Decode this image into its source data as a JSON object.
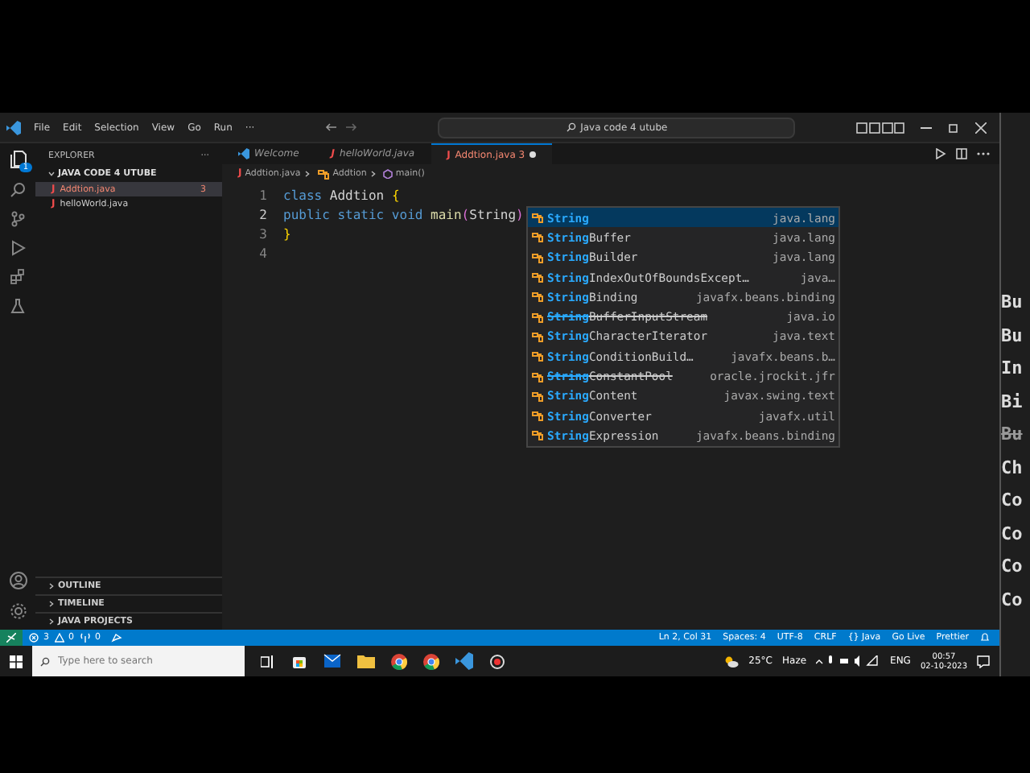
{
  "menu": [
    "File",
    "Edit",
    "Selection",
    "View",
    "Go",
    "Run",
    "···"
  ],
  "command_center": "Java code 4 utube",
  "activity_badge": "1",
  "sidebar": {
    "title": "EXPLORER",
    "more": "···",
    "folder": "JAVA CODE 4 UTUBE",
    "files": [
      {
        "icon": "J",
        "name": "Addtion.java",
        "problems": "3",
        "selected": true
      },
      {
        "icon": "J",
        "name": "helloWorld.java",
        "selected": false
      }
    ],
    "sections": [
      "OUTLINE",
      "TIMELINE",
      "JAVA PROJECTS"
    ]
  },
  "tabs": [
    {
      "label": "Welcome",
      "kind": "welcome",
      "selected": false,
      "dirty": false
    },
    {
      "icon": "J",
      "label": "helloWorld.java",
      "kind": "java",
      "selected": false,
      "dirty": false
    },
    {
      "icon": "J",
      "label": "Addtion.java 3",
      "kind": "java",
      "selected": true,
      "dirty": true
    }
  ],
  "breadcrumb": [
    {
      "icon": "J",
      "label": "Addtion.java",
      "kind": "file"
    },
    {
      "label": "Addtion",
      "kind": "class"
    },
    {
      "label": "main()",
      "kind": "method"
    }
  ],
  "lines": [
    {
      "number": "1",
      "tokens": [
        {
          "text": "class",
          "kind": "keyword"
        },
        {
          "text": " Addtion ",
          "kind": "plain"
        },
        {
          "text": "{",
          "kind": "brace"
        }
      ]
    },
    {
      "number": "2",
      "tokens": [
        {
          "text": "public static void",
          "kind": "keyword"
        },
        {
          "text": " main",
          "kind": "function"
        },
        {
          "text": "(",
          "kind": "paren"
        },
        {
          "text": "String",
          "kind": "plain"
        },
        {
          "text": ")",
          "kind": "paren"
        }
      ]
    },
    {
      "number": "3",
      "tokens": [
        {
          "text": "}",
          "kind": "brace"
        }
      ]
    },
    {
      "number": "4"
    }
  ],
  "suggestions": [
    {
      "match": "String",
      "package": "java.lang",
      "deprecated": false,
      "selected": true
    },
    {
      "match": "String",
      "rest": "Buffer",
      "package": "java.lang",
      "deprecated": false,
      "selected": false
    },
    {
      "match": "String",
      "rest": "Builder",
      "package": "java.lang",
      "deprecated": false,
      "selected": false
    },
    {
      "match": "String",
      "rest": "IndexOutOfBoundsExcept…",
      "package": "java…",
      "deprecated": false,
      "selected": false
    },
    {
      "match": "String",
      "rest": "Binding",
      "package": "javafx.beans.binding",
      "deprecated": false,
      "selected": false
    },
    {
      "match": "String",
      "rest": "BufferInputStream",
      "package": "java.io",
      "deprecated": true,
      "selected": false
    },
    {
      "match": "String",
      "rest": "CharacterIterator",
      "package": "java.text",
      "deprecated": false,
      "selected": false
    },
    {
      "match": "String",
      "rest": "ConditionBuild…",
      "package": "javafx.beans.b…",
      "deprecated": false,
      "selected": false
    },
    {
      "match": "String",
      "rest": "ConstantPool",
      "package": "oracle.jrockit.jfr",
      "deprecated": true,
      "selected": false
    },
    {
      "match": "String",
      "rest": "Content",
      "package": "javax.swing.text",
      "deprecated": false,
      "selected": false
    },
    {
      "match": "String",
      "rest": "Converter",
      "package": "javafx.util",
      "deprecated": false,
      "selected": false
    },
    {
      "match": "String",
      "rest": "Expression",
      "package": "javafx.beans.binding",
      "deprecated": false,
      "selected": false
    }
  ],
  "status_bar": {
    "errors": "3",
    "warnings": "0",
    "ports": "0",
    "right": [
      "Ln 2, Col 31",
      "Spaces: 4",
      "UTF-8",
      "CRLF",
      "{} Java",
      "Go Live",
      "Prettier"
    ]
  },
  "taskbar": {
    "search_placeholder": "Type here to search",
    "temperature": "25°C",
    "weather": "Haze",
    "language": "ENG",
    "time": "00:57",
    "date": "02-10-2023"
  },
  "overlay_fragments": [
    {
      "text": "Bu",
      "deprecated": false
    },
    {
      "text": "Bu",
      "deprecated": false
    },
    {
      "text": "In",
      "deprecated": false
    },
    {
      "text": "Bi",
      "deprecated": false
    },
    {
      "text": "Bu",
      "deprecated": true
    },
    {
      "text": "Ch",
      "deprecated": false
    },
    {
      "text": "Co",
      "deprecated": false
    },
    {
      "text": "Co",
      "deprecated": false
    },
    {
      "text": "Co",
      "deprecated": false
    },
    {
      "text": "Co",
      "deprecated": false
    }
  ]
}
